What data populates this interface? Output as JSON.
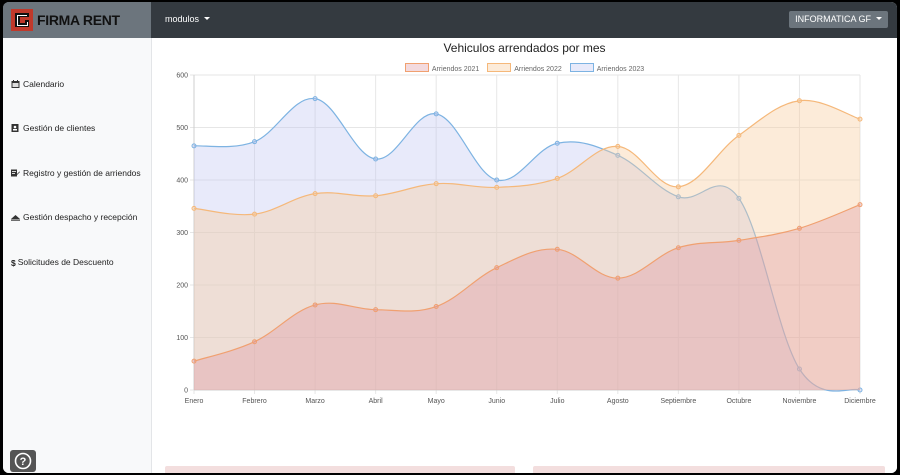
{
  "app": {
    "brand_name": "FIRMA RENT",
    "brand_colors": {
      "mark": "#c0392b",
      "text": "#111111"
    }
  },
  "topbar": {
    "modules_label": "modulos",
    "user_label": "INFORMATICA GF"
  },
  "sidebar": {
    "items": [
      {
        "label": "Calendario",
        "icon": "calendar-icon"
      },
      {
        "label": "Gestión de clientes",
        "icon": "contact-card-icon"
      },
      {
        "label": "Registro y gestión de arriendos",
        "icon": "edit-note-icon"
      },
      {
        "label": "Gestión despacho y recepción",
        "icon": "truck-loading-icon"
      },
      {
        "label": "Solicitudes de Descuento",
        "icon": "dollar-icon"
      }
    ],
    "help_icon": "question-circle-icon"
  },
  "chart_data": {
    "type": "area",
    "title": "Vehiculos arrendados por mes",
    "xlabel": "",
    "ylabel": "",
    "ylim": [
      0,
      600
    ],
    "yticks": [
      0,
      100,
      200,
      300,
      400,
      500,
      600
    ],
    "grid": true,
    "legend_position": "top",
    "categories": [
      "Enero",
      "Febrero",
      "Marzo",
      "Abril",
      "Mayo",
      "Junio",
      "Julio",
      "Agosto",
      "Septiembre",
      "Octubre",
      "Noviembre",
      "Diciembre"
    ],
    "series": [
      {
        "name": "Arriendos 2021",
        "color": "#f0a070",
        "fill": "rgba(220,150,160,0.35)",
        "values": [
          55,
          92,
          162,
          153,
          159,
          233,
          268,
          213,
          271,
          285,
          308,
          353
        ]
      },
      {
        "name": "Arriendos 2022",
        "color": "#f5b87a",
        "fill": "rgba(248,205,160,0.40)",
        "values": [
          346,
          335,
          374,
          370,
          393,
          386,
          403,
          464,
          387,
          485,
          551,
          516
        ]
      },
      {
        "name": "Arriendos 2023",
        "color": "#7db3e2",
        "fill": "rgba(190,195,240,0.35)",
        "values": [
          465,
          473,
          555,
          440,
          526,
          400,
          470,
          447,
          368,
          365,
          40,
          0
        ]
      }
    ]
  }
}
